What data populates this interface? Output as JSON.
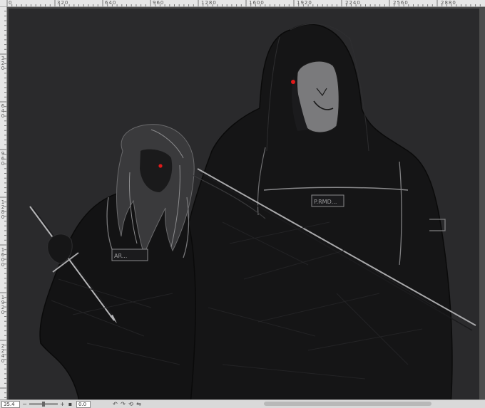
{
  "rulers": {
    "top_labels": [
      "0",
      "320",
      "640",
      "960",
      "1280",
      "1600",
      "1920",
      "2240",
      "2560",
      "2880"
    ],
    "left_labels": [
      "320",
      "640",
      "960",
      "1280",
      "1600",
      "1920",
      "2240"
    ]
  },
  "status_bar": {
    "zoom": "35.4",
    "angle": "0.0"
  },
  "artwork": {
    "left_badge_text": "AR...",
    "right_badge_text": "P.RMD..."
  }
}
